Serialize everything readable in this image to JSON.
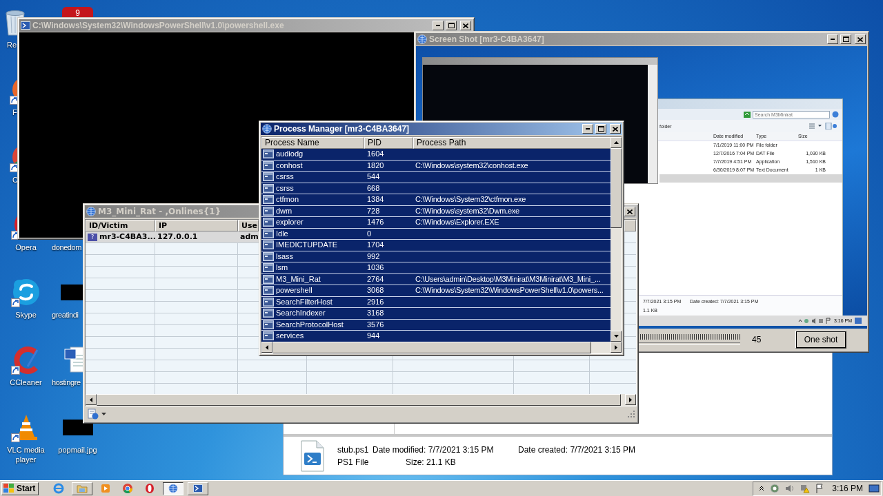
{
  "desktop_icons": [
    {
      "kind": "recycle",
      "label": "Re",
      "shortcut": false
    },
    {
      "kind": "firefox",
      "label": "F",
      "shortcut": true
    },
    {
      "kind": "chrome",
      "label": "C",
      "shortcut": true
    },
    {
      "kind": "opera",
      "label": "Opera",
      "shortcut": true
    },
    {
      "kind": "skype",
      "label": "Skype",
      "shortcut": true
    },
    {
      "kind": "ccleaner",
      "label": "CCleaner",
      "shortcut": true
    },
    {
      "kind": "vlc",
      "label": "VLC media player",
      "shortcut": true
    },
    {
      "kind": "red-app",
      "glyph": "9"
    },
    {
      "kind": "blank",
      "label": "donedom"
    },
    {
      "kind": "black",
      "label": "greatindi",
      "shortcut": false
    },
    {
      "kind": "word",
      "label": "hostingre",
      "shortcut": false
    },
    {
      "kind": "black",
      "label": "popmail.jpg",
      "shortcut": false
    }
  ],
  "powershell_window": {
    "title": "C:\\Windows\\System32\\WindowsPowerShell\\v1.0\\powershell.exe",
    "active": false
  },
  "screenshot_window": {
    "title": "Screen Shot [mr3-C4BA3647]",
    "active": false,
    "capture": {
      "search_placeholder": "Search M3Minirat",
      "toolbar_text": "folder",
      "columns": [
        "Date modified",
        "Type",
        "Size"
      ],
      "rows": [
        {
          "date": "7/1/2019 11:00 PM",
          "type": "File folder",
          "selected": false
        },
        {
          "date": "12/7/2016 7:04 PM",
          "type": "DAT File",
          "size": "1,030 KB",
          "selected": false
        },
        {
          "date": "7/7/2019 4:51 PM",
          "type": "Application",
          "size": "1,510 KB",
          "selected": false
        },
        {
          "date": "6/30/2019 8:07 PM",
          "type": "Text Document",
          "size": "1 KB",
          "selected": false
        },
        {
          "selected": true
        }
      ],
      "details": [
        "7/7/2021 3:15 PM",
        "Date created: 7/7/2021 3:15 PM",
        "1.1 KB"
      ],
      "clock": "3:16 PM"
    },
    "slider_reading": "45",
    "button": "One shot"
  },
  "explorer_window": {
    "file_name": "stub.ps1",
    "date_modified": "Date modified: 7/7/2021 3:15 PM",
    "date_created": "Date created: 7/7/2021 3:15 PM",
    "file_type": "PS1 File",
    "size": "Size: 21.1 KB"
  },
  "rat_window": {
    "title": "M3_Mini_Rat - ,Onlines{1}",
    "active": false,
    "columns": [
      "ID/Victim",
      "IP",
      "Use"
    ],
    "rows": [
      {
        "icon_glyph": "?",
        "cells": [
          "mr3-C4BA3...",
          "127.0.0.1",
          "adm"
        ],
        "selected": true
      }
    ]
  },
  "process_manager": {
    "title": "Process Manager [mr3-C4BA3647]",
    "active": true,
    "columns": [
      "Process Name",
      "PID",
      "Process Path"
    ],
    "rows": [
      {
        "name": "audiodg",
        "pid": "1604",
        "selected": true
      },
      {
        "name": "conhost",
        "pid": "1820",
        "path": "C:\\Windows\\system32\\conhost.exe",
        "selected": true
      },
      {
        "name": "csrss",
        "pid": "544",
        "selected": true
      },
      {
        "name": "csrss",
        "pid": "668",
        "selected": true
      },
      {
        "name": "ctfmon",
        "pid": "1384",
        "path": "C:\\Windows\\System32\\ctfmon.exe",
        "selected": true
      },
      {
        "name": "dwm",
        "pid": "728",
        "path": "C:\\Windows\\system32\\Dwm.exe",
        "selected": true
      },
      {
        "name": "explorer",
        "pid": "1476",
        "path": "C:\\Windows\\Explorer.EXE",
        "selected": true
      },
      {
        "name": "Idle",
        "pid": "0",
        "selected": true
      },
      {
        "name": "IMEDICTUPDATE",
        "pid": "1704",
        "selected": true
      },
      {
        "name": "lsass",
        "pid": "992",
        "selected": true
      },
      {
        "name": "lsm",
        "pid": "1036",
        "selected": true
      },
      {
        "name": "M3_Mini_Rat",
        "pid": "2764",
        "path": "C:\\Users\\admin\\Desktop\\M3Minirat\\M3Minirat\\M3_Mini_...",
        "selected": true
      },
      {
        "name": "powershell",
        "pid": "3068",
        "path": "C:\\Windows\\System32\\WindowsPowerShell\\v1.0\\powers...",
        "selected": true
      },
      {
        "name": "SearchFilterHost",
        "pid": "2916",
        "selected": true
      },
      {
        "name": "SearchIndexer",
        "pid": "3168",
        "selected": true
      },
      {
        "name": "SearchProtocolHost",
        "pid": "3576",
        "selected": true
      },
      {
        "name": "services",
        "pid": "944",
        "selected": true
      }
    ]
  },
  "taskbar": {
    "start": "Start",
    "buttons": [
      {
        "kind": "ie",
        "running": false,
        "selected": false
      },
      {
        "kind": "folder",
        "running": true,
        "selected": false
      },
      {
        "kind": "media",
        "running": false,
        "selected": false
      },
      {
        "kind": "chrome",
        "running": false,
        "selected": false
      },
      {
        "kind": "opera",
        "running": false,
        "selected": false
      },
      {
        "kind": "globe",
        "running": true,
        "selected": true
      },
      {
        "kind": "powershell",
        "running": true,
        "selected": false
      }
    ],
    "clock": "3:16 PM"
  }
}
